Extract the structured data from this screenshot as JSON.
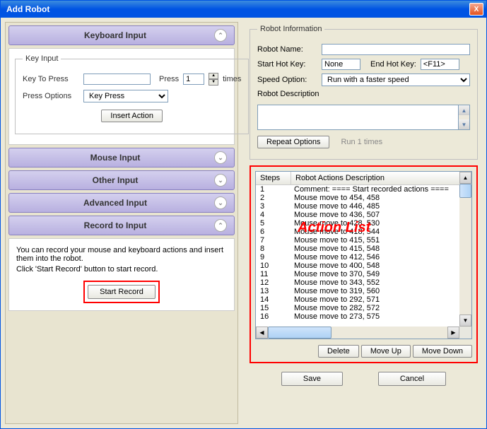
{
  "window": {
    "title": "Add Robot",
    "close": "X"
  },
  "left": {
    "keyboard": {
      "header": "Keyboard Input",
      "key_input_legend": "Key Input",
      "key_to_press_label": "Key To Press",
      "press_label": "Press",
      "press_count": "1",
      "times_label": "times",
      "press_options_label": "Press Options",
      "press_options_value": "Key Press",
      "insert_action": "Insert Action"
    },
    "mouse_header": "Mouse Input",
    "other_header": "Other Input",
    "advanced_header": "Advanced Input",
    "record": {
      "header": "Record to Input",
      "text1": "You can record your mouse and keyboard actions and insert them into the robot.",
      "text2": "Click 'Start Record' button to start record.",
      "start_record": "Start Record"
    }
  },
  "right": {
    "info_legend": "Robot Information",
    "name_label": "Robot Name:",
    "name_value": "",
    "start_hotkey_label": "Start Hot Key:",
    "start_hotkey_value": "None",
    "end_hotkey_label": "End Hot Key:",
    "end_hotkey_value": "<F11>",
    "speed_label": "Speed Option:",
    "speed_value": "Run with a faster speed",
    "desc_label": "Robot Description",
    "desc_value": "",
    "repeat_options": "Repeat Options",
    "repeat_status": "Run 1 times",
    "steps_header": "Steps",
    "actions_header": "Robot Actions Description",
    "rows": [
      {
        "step": "1",
        "desc": "Comment: ==== Start recorded actions ===="
      },
      {
        "step": "2",
        "desc": "Mouse move to 454, 458"
      },
      {
        "step": "3",
        "desc": "Mouse move to 446, 485"
      },
      {
        "step": "4",
        "desc": "Mouse move to 436, 507"
      },
      {
        "step": "5",
        "desc": "Mouse move to 428, 530"
      },
      {
        "step": "6",
        "desc": "Mouse move to 418, 544"
      },
      {
        "step": "7",
        "desc": "Mouse move to 415, 551"
      },
      {
        "step": "8",
        "desc": "Mouse move to 415, 548"
      },
      {
        "step": "9",
        "desc": "Mouse move to 412, 546"
      },
      {
        "step": "10",
        "desc": "Mouse move to 400, 548"
      },
      {
        "step": "11",
        "desc": "Mouse move to 370, 549"
      },
      {
        "step": "12",
        "desc": "Mouse move to 343, 552"
      },
      {
        "step": "13",
        "desc": "Mouse move to 319, 560"
      },
      {
        "step": "14",
        "desc": "Mouse move to 292, 571"
      },
      {
        "step": "15",
        "desc": "Mouse move to 282, 572"
      },
      {
        "step": "16",
        "desc": "Mouse move to 273, 575"
      }
    ],
    "delete": "Delete",
    "move_up": "Move Up",
    "move_down": "Move Down",
    "save": "Save",
    "cancel": "Cancel",
    "overlay": "Action List"
  }
}
